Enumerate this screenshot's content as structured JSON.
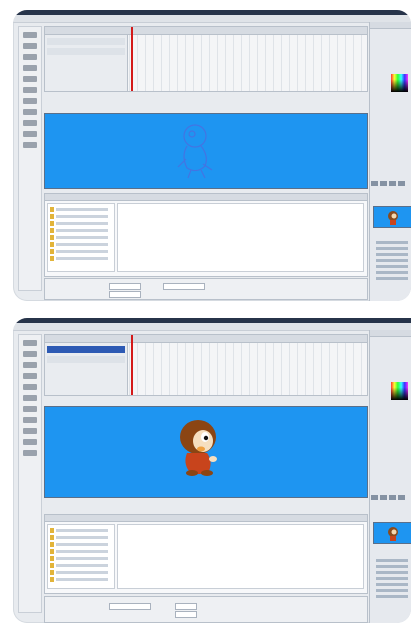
{
  "colors": {
    "stage_blue": "#1e95f1",
    "window_title": "#27344a",
    "playhead": "#d41a1a"
  },
  "screens": [
    {
      "id": "before",
      "character": "character-outline",
      "timeline_layers": 2
    },
    {
      "id": "after",
      "character": "character-colored",
      "timeline_layers": 2
    }
  ]
}
